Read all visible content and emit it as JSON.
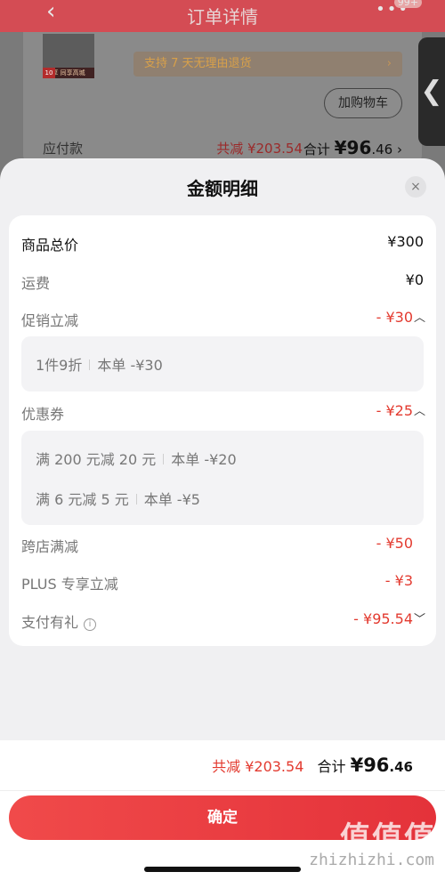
{
  "background": {
    "header_title": "订单详情",
    "back_glyph": "‹",
    "more_glyph": "•••",
    "badge": "99+",
    "thumb_tag": "10",
    "thumb_label": "享 同享高城",
    "return_policy": "支持 7 天无理由退货",
    "add_cart_label": "加购物车",
    "payable_label": "应付款",
    "reduce_total": "共减 ¥203.54",
    "total_label": "合计 ",
    "total_amount": "¥96",
    "total_decimal": ".46",
    "side_tab_glyph": "❮"
  },
  "sheet": {
    "title": "金额明细",
    "close_glyph": "×",
    "rows": {
      "goods_total": {
        "label": "商品总价",
        "value": "¥300"
      },
      "shipping": {
        "label": "运费",
        "value": "¥0"
      },
      "promotion": {
        "label": "促销立减",
        "value": "- ¥30"
      },
      "coupon": {
        "label": "优惠券",
        "value": "- ¥25"
      },
      "cross_store": {
        "label": "跨店满减",
        "value": "- ¥50"
      },
      "plus": {
        "label": "PLUS 专享立减",
        "value": "- ¥3"
      },
      "payment_gift": {
        "label": "支付有礼",
        "value": "- ¥95.54"
      }
    },
    "promotion_details": [
      {
        "name": "1件9折",
        "amount": "本单 -¥30"
      }
    ],
    "coupon_details": [
      {
        "name": "满 200 元减 20 元",
        "amount": "本单 -¥20"
      },
      {
        "name": "满 6 元减 5 元",
        "amount": "本单 -¥5"
      }
    ]
  },
  "bottom": {
    "reduce_text": "共减 ¥203.54",
    "total_label": "合计 ",
    "total_amount": "¥96",
    "total_decimal": ".46",
    "confirm_label": "确定",
    "watermark": "值值值",
    "watermark_url": "zhizhizhi.com"
  },
  "colors": {
    "accent_red": "#e33a2f",
    "button_red": "#e8424c"
  },
  "icons": {
    "chevron_up": "chevron-up-icon",
    "chevron_down": "chevron-down-icon",
    "info": "info-icon",
    "close": "close-icon",
    "back": "back-icon"
  }
}
